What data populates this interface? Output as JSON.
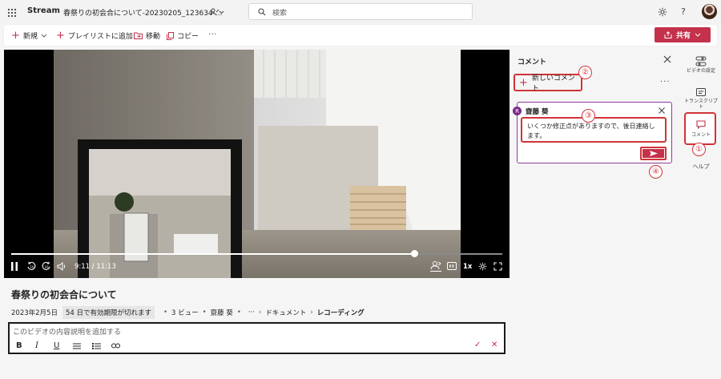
{
  "app": {
    "name": "Stream",
    "doc_title": "春祭りの初会合について-20230205_123634-...",
    "search_placeholder": "検索"
  },
  "toolbar": {
    "new_label": "新規",
    "add_playlist_label": "プレイリストに追加",
    "move_label": "移動",
    "copy_label": "コピー",
    "more_label": "···",
    "share_label": "共有"
  },
  "player": {
    "current_time": "9:11",
    "duration": "11:13",
    "time_display": "9:11 / 11:13",
    "progress": 0.82,
    "speed_label": "1x",
    "rewind_label": "10",
    "forward_label": "10"
  },
  "video": {
    "title": "春祭りの初会合について",
    "date": "2023年2月5日",
    "expiry_badge": "54 日で有効期限が切れます",
    "views": "3 ビュー",
    "owner": "齋藤 葵",
    "breadcrumb_more": "···",
    "breadcrumb_1": "ドキュメント",
    "breadcrumb_2": "レコーディング",
    "description_placeholder": "このビデオの内容説明を追加する"
  },
  "comments": {
    "panel_title": "コメント",
    "new_comment_label": "新しいコメント",
    "author_initial": "R",
    "author_name": "齋藤 葵",
    "draft_text": "いくつか修正点がありますので、後日連絡します。"
  },
  "annotations": [
    "①",
    "②",
    "③",
    "④"
  ],
  "rail": {
    "video_settings_label": "ビデオの設定",
    "transcript_label": "トランスクリプト",
    "comment_label": "コメント",
    "help_label": "ヘルプ"
  },
  "colors": {
    "accent": "#c4314b",
    "highlight": "#d13438",
    "card_border": "#8e3c9b"
  }
}
